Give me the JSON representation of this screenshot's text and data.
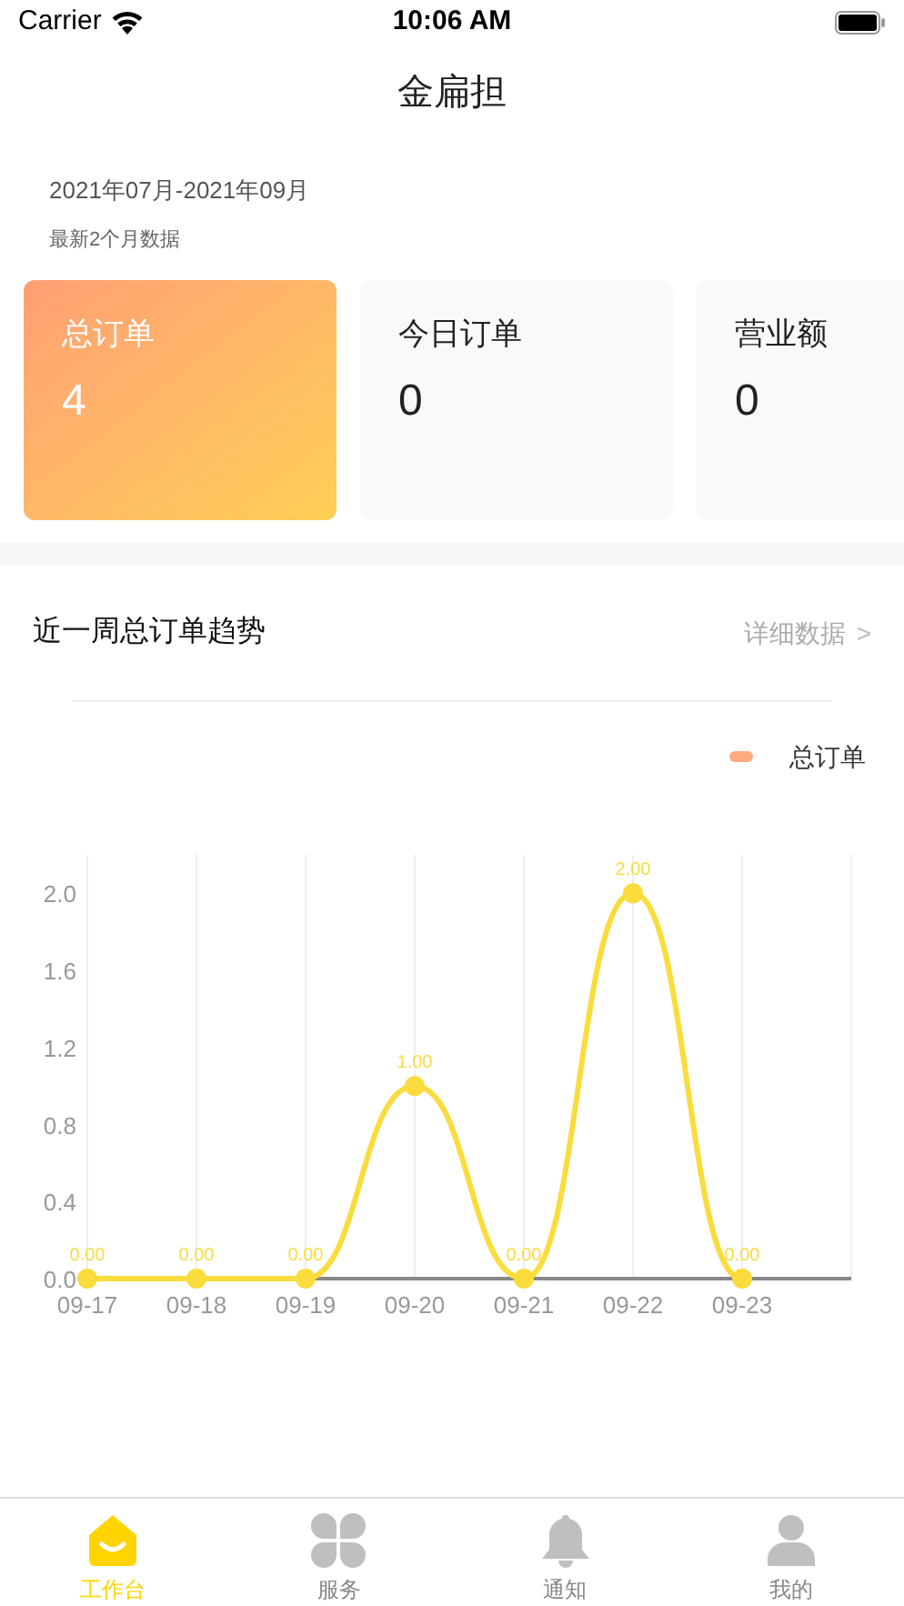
{
  "status_bar": {
    "carrier": "Carrier",
    "time": "10:06 AM"
  },
  "nav": {
    "title": "金扁担"
  },
  "period": {
    "range": "2021年07月-2021年09月",
    "note": "最新2个月数据"
  },
  "cards": [
    {
      "label": "总订单",
      "value": "4",
      "highlighted": true
    },
    {
      "label": "今日订单",
      "value": "0",
      "highlighted": false
    },
    {
      "label": "营业额",
      "value": "0",
      "highlighted": false
    }
  ],
  "trend": {
    "title": "近一周总订单趋势",
    "link": "详细数据",
    "chevron": ">",
    "legend": {
      "color": "#ffa97e"
    },
    "chart_data": {
      "type": "line",
      "categories": [
        "09-17",
        "09-18",
        "09-19",
        "09-20",
        "09-21",
        "09-22",
        "09-23"
      ],
      "grid": true,
      "series": [
        {
          "name": "总订单",
          "color": "#fadc3c",
          "marker": true,
          "values": [
            0,
            0,
            0,
            1,
            0,
            2,
            0
          ]
        }
      ],
      "value_labels": [
        "0.00",
        "0.00",
        "0.00",
        "1.00",
        "0.00",
        "2.00",
        "0.00"
      ],
      "ylim": [
        0,
        2.2
      ],
      "yticks": [
        {
          "value": 0,
          "label": "0.0"
        },
        {
          "value": 0.4,
          "label": "0.4"
        },
        {
          "value": 0.8,
          "label": "0.8"
        },
        {
          "value": 1.2,
          "label": "1.2"
        },
        {
          "value": 1.6,
          "label": "1.6"
        },
        {
          "value": 2.0,
          "label": "2.0"
        }
      ]
    }
  },
  "tab_bar": [
    {
      "label": "工作台",
      "selected": true
    },
    {
      "label": "服务",
      "selected": false
    },
    {
      "label": "通知",
      "selected": false
    },
    {
      "label": "我的",
      "selected": false
    }
  ]
}
